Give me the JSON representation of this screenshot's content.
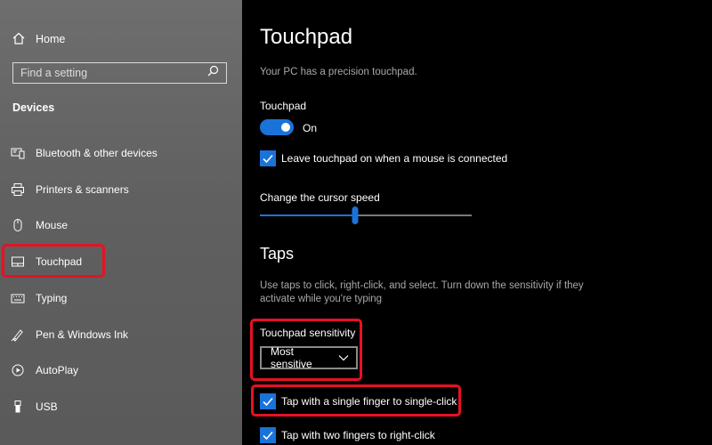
{
  "sidebar": {
    "home_label": "Home",
    "search_placeholder": "Find a setting",
    "section_title": "Devices",
    "items": [
      {
        "label": "Bluetooth & other devices",
        "icon": "bluetooth-devices-icon"
      },
      {
        "label": "Printers & scanners",
        "icon": "printer-icon"
      },
      {
        "label": "Mouse",
        "icon": "mouse-icon"
      },
      {
        "label": "Touchpad",
        "icon": "touchpad-icon",
        "active": true
      },
      {
        "label": "Typing",
        "icon": "keyboard-icon"
      },
      {
        "label": "Pen & Windows Ink",
        "icon": "pen-icon"
      },
      {
        "label": "AutoPlay",
        "icon": "autoplay-icon"
      },
      {
        "label": "USB",
        "icon": "usb-icon"
      }
    ]
  },
  "main": {
    "title": "Touchpad",
    "subtext": "Your PC has a precision touchpad.",
    "touchpad_toggle": {
      "label": "Touchpad",
      "state_text": "On",
      "on": true
    },
    "leave_on_checkbox": {
      "label": "Leave touchpad on when a mouse is connected",
      "checked": true
    },
    "cursor_speed": {
      "label": "Change the cursor speed",
      "value_fraction": 0.45
    },
    "taps": {
      "heading": "Taps",
      "description": "Use taps to click, right-click, and select. Turn down the sensitivity if they activate while you're typing",
      "sensitivity_label": "Touchpad sensitivity",
      "sensitivity_value": "Most sensitive",
      "single_finger": {
        "label": "Tap with a single finger to single-click",
        "checked": true
      },
      "two_fingers": {
        "label": "Tap with two fingers to right-click",
        "checked": true
      }
    }
  },
  "colors": {
    "accent": "#1a73d8",
    "highlight_red": "#e81123",
    "sidebar_bg": "#606060",
    "main_bg": "#000000"
  }
}
